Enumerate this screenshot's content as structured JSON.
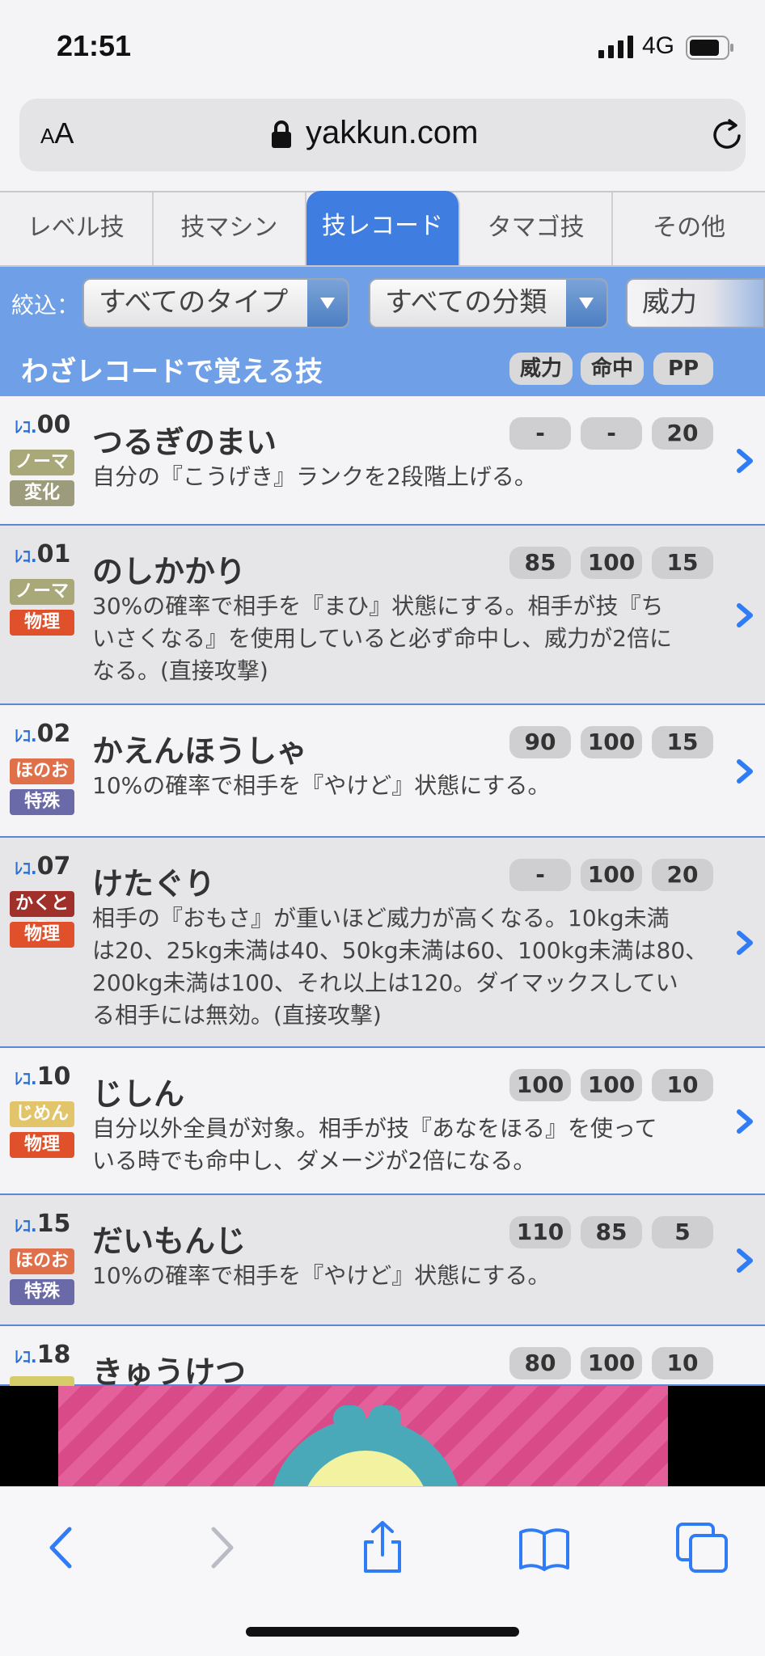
{
  "status_bar": {
    "time": "21:51",
    "network": "4G"
  },
  "browser": {
    "text_size_label": "AA",
    "domain": "yakkun.com"
  },
  "tabs": [
    {
      "label": "レベル技",
      "active": false
    },
    {
      "label": "技マシン",
      "active": false
    },
    {
      "label": "技レコード",
      "active": true
    },
    {
      "label": "タマゴ技",
      "active": false
    },
    {
      "label": "その他",
      "active": false
    }
  ],
  "filter": {
    "label": "絞込：",
    "type_select": "すべてのタイプ",
    "category_select": "すべての分類",
    "sort_select": "威力"
  },
  "section": {
    "title": "わざレコードで覚える技",
    "col_power": "威力",
    "col_accuracy": "命中",
    "col_pp": "PP"
  },
  "moves": [
    {
      "level_prefix": "ﾚｺ.",
      "num": "00",
      "name": "つるぎのまい",
      "type": "ノーマル",
      "category": "変化",
      "power": "-",
      "accuracy": "-",
      "pp": "20",
      "desc": [
        "自分の『こうげき』ランクを2段階上げる。"
      ]
    },
    {
      "level_prefix": "ﾚｺ.",
      "num": "01",
      "name": "のしかかり",
      "type": "ノーマル",
      "category": "物理",
      "power": "85",
      "accuracy": "100",
      "pp": "15",
      "desc": [
        "30%の確率で相手を『まひ』状態にする。相手が技『ち",
        "いさくなる』を使用していると必ず命中し、威力が2倍に",
        "なる。(直接攻撃)"
      ]
    },
    {
      "level_prefix": "ﾚｺ.",
      "num": "02",
      "name": "かえんほうしゃ",
      "type": "ほのお",
      "category": "特殊",
      "power": "90",
      "accuracy": "100",
      "pp": "15",
      "desc": [
        "10%の確率で相手を『やけど』状態にする。"
      ]
    },
    {
      "level_prefix": "ﾚｺ.",
      "num": "07",
      "name": "けたぐり",
      "type": "かくとう",
      "category": "物理",
      "power": "-",
      "accuracy": "100",
      "pp": "20",
      "desc": [
        "相手の『おもさ』が重いほど威力が高くなる。10kg未満",
        "は20、25kg未満は40、50kg未満は60、100kg未満は80、",
        "200kg未満は100、それ以上は120。ダイマックスしてい",
        "る相手には無効。(直接攻撃)"
      ]
    },
    {
      "level_prefix": "ﾚｺ.",
      "num": "10",
      "name": "じしん",
      "type": "じめん",
      "category": "物理",
      "power": "100",
      "accuracy": "100",
      "pp": "10",
      "desc": [
        "自分以外全員が対象。相手が技『あなをほる』を使って",
        "いる時でも命中し、ダメージが2倍になる。"
      ]
    },
    {
      "level_prefix": "ﾚｺ.",
      "num": "15",
      "name": "だいもんじ",
      "type": "ほのお",
      "category": "特殊",
      "power": "110",
      "accuracy": "85",
      "pp": "5",
      "desc": [
        "10%の確率で相手を『やけど』状態にする。"
      ]
    },
    {
      "level_prefix": "ﾚｺ.",
      "num": "18",
      "name": "きゅうけつ",
      "type": "",
      "category": "",
      "power": "80",
      "accuracy": "100",
      "pp": "10",
      "desc": []
    }
  ],
  "colors": {
    "tab_active": "#3f7de0",
    "header_bar": "#6f9fe6",
    "row_divider": "#5b88d6",
    "type_normal": "#a8a878",
    "type_fire": "#e0704a",
    "type_fighting": "#a0302a",
    "type_ground": "#e2c46a",
    "cat_status": "#9c9c7c",
    "cat_physical": "#e0502a",
    "cat_special": "#6a6aa8"
  },
  "icons": {
    "lock": "lock-icon",
    "reload": "reload-icon",
    "chevron": "chevron-right-icon",
    "back": "back-icon",
    "forward": "forward-icon",
    "share": "share-icon",
    "bookmarks": "bookmarks-icon",
    "tabs": "tabs-icon"
  }
}
